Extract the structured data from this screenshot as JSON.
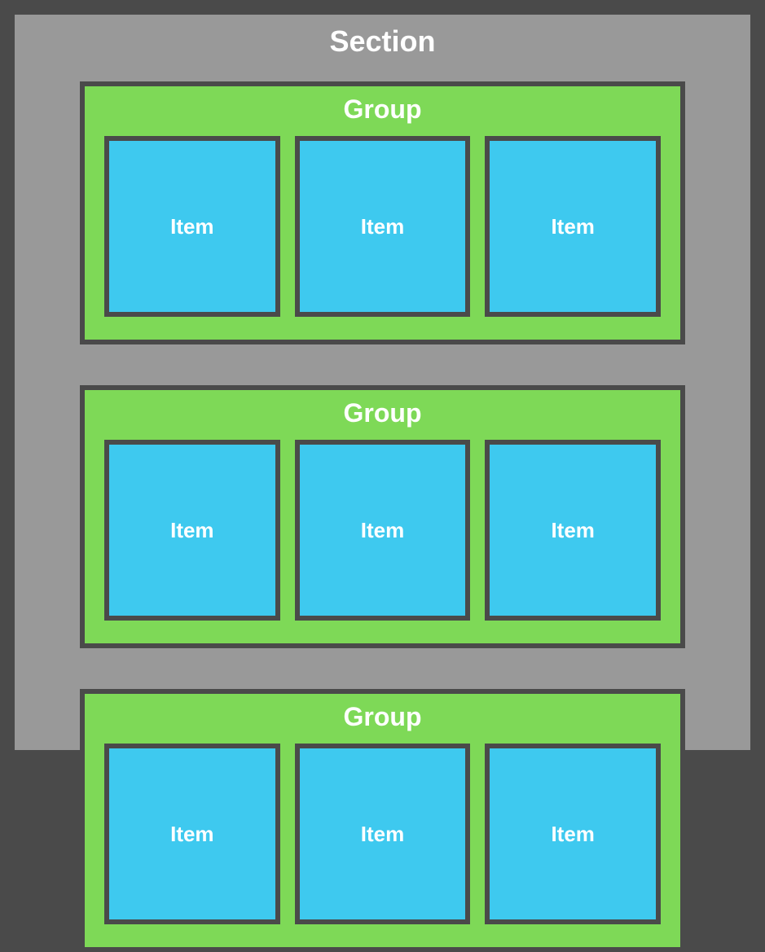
{
  "section": {
    "title": "Section",
    "groups": [
      {
        "title": "Group",
        "items": [
          {
            "label": "Item"
          },
          {
            "label": "Item"
          },
          {
            "label": "Item"
          }
        ]
      },
      {
        "title": "Group",
        "items": [
          {
            "label": "Item"
          },
          {
            "label": "Item"
          },
          {
            "label": "Item"
          }
        ]
      },
      {
        "title": "Group",
        "items": [
          {
            "label": "Item"
          },
          {
            "label": "Item"
          },
          {
            "label": "Item"
          }
        ]
      }
    ]
  },
  "colors": {
    "outer_border": "#4a4a4a",
    "section_bg": "#999999",
    "group_bg": "#7ed957",
    "item_bg": "#3ec9ef",
    "text": "#ffffff"
  }
}
